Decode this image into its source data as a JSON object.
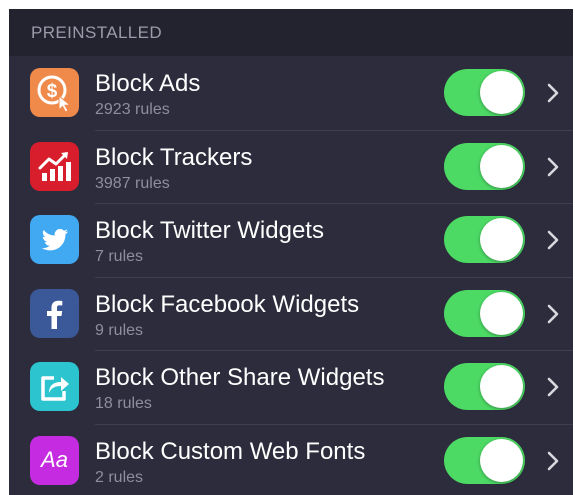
{
  "section": {
    "title": "PREINSTALLED"
  },
  "colors": {
    "toggle_on": "#4cd964",
    "background": "#2c2c3c",
    "header_background": "#232330"
  },
  "rules": [
    {
      "title": "Block Ads",
      "subtitle": "2923 rules",
      "icon": "dollar-cursor-icon",
      "icon_color": "#f08a4b",
      "enabled": true
    },
    {
      "title": "Block Trackers",
      "subtitle": "3987 rules",
      "icon": "chart-trend-icon",
      "icon_color": "#d81e2d",
      "enabled": true
    },
    {
      "title": "Block Twitter Widgets",
      "subtitle": "7 rules",
      "icon": "twitter-bird-icon",
      "icon_color": "#41a9f2",
      "enabled": true
    },
    {
      "title": "Block Facebook Widgets",
      "subtitle": "9 rules",
      "icon": "facebook-icon",
      "icon_color": "#3b5998",
      "enabled": true
    },
    {
      "title": "Block Other Share Widgets",
      "subtitle": "18 rules",
      "icon": "share-icon",
      "icon_color": "#2bc4cf",
      "enabled": true
    },
    {
      "title": "Block Custom Web Fonts",
      "subtitle": "2 rules",
      "icon": "font-icon",
      "icon_color": "#c52be0",
      "icon_text": "Aa",
      "enabled": true
    }
  ]
}
